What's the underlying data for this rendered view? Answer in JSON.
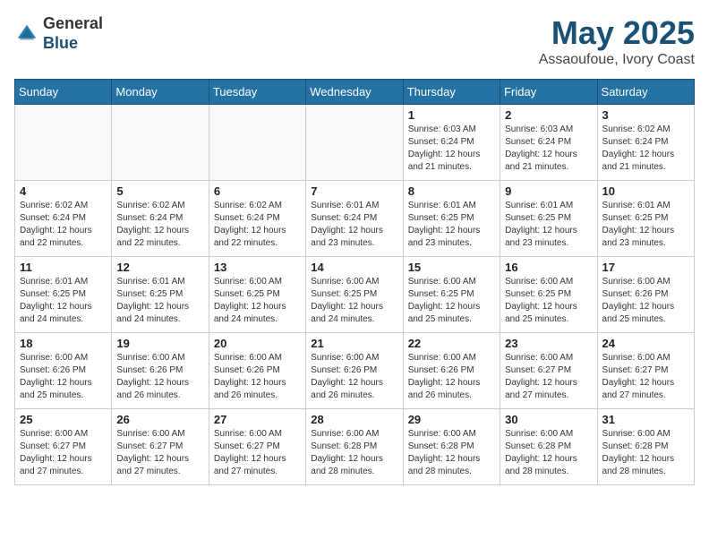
{
  "header": {
    "logo_general": "General",
    "logo_blue": "Blue",
    "month": "May 2025",
    "location": "Assaoufoue, Ivory Coast"
  },
  "weekdays": [
    "Sunday",
    "Monday",
    "Tuesday",
    "Wednesday",
    "Thursday",
    "Friday",
    "Saturday"
  ],
  "weeks": [
    [
      {
        "day": "",
        "info": ""
      },
      {
        "day": "",
        "info": ""
      },
      {
        "day": "",
        "info": ""
      },
      {
        "day": "",
        "info": ""
      },
      {
        "day": "1",
        "info": "Sunrise: 6:03 AM\nSunset: 6:24 PM\nDaylight: 12 hours\nand 21 minutes."
      },
      {
        "day": "2",
        "info": "Sunrise: 6:03 AM\nSunset: 6:24 PM\nDaylight: 12 hours\nand 21 minutes."
      },
      {
        "day": "3",
        "info": "Sunrise: 6:02 AM\nSunset: 6:24 PM\nDaylight: 12 hours\nand 21 minutes."
      }
    ],
    [
      {
        "day": "4",
        "info": "Sunrise: 6:02 AM\nSunset: 6:24 PM\nDaylight: 12 hours\nand 22 minutes."
      },
      {
        "day": "5",
        "info": "Sunrise: 6:02 AM\nSunset: 6:24 PM\nDaylight: 12 hours\nand 22 minutes."
      },
      {
        "day": "6",
        "info": "Sunrise: 6:02 AM\nSunset: 6:24 PM\nDaylight: 12 hours\nand 22 minutes."
      },
      {
        "day": "7",
        "info": "Sunrise: 6:01 AM\nSunset: 6:24 PM\nDaylight: 12 hours\nand 23 minutes."
      },
      {
        "day": "8",
        "info": "Sunrise: 6:01 AM\nSunset: 6:25 PM\nDaylight: 12 hours\nand 23 minutes."
      },
      {
        "day": "9",
        "info": "Sunrise: 6:01 AM\nSunset: 6:25 PM\nDaylight: 12 hours\nand 23 minutes."
      },
      {
        "day": "10",
        "info": "Sunrise: 6:01 AM\nSunset: 6:25 PM\nDaylight: 12 hours\nand 23 minutes."
      }
    ],
    [
      {
        "day": "11",
        "info": "Sunrise: 6:01 AM\nSunset: 6:25 PM\nDaylight: 12 hours\nand 24 minutes."
      },
      {
        "day": "12",
        "info": "Sunrise: 6:01 AM\nSunset: 6:25 PM\nDaylight: 12 hours\nand 24 minutes."
      },
      {
        "day": "13",
        "info": "Sunrise: 6:00 AM\nSunset: 6:25 PM\nDaylight: 12 hours\nand 24 minutes."
      },
      {
        "day": "14",
        "info": "Sunrise: 6:00 AM\nSunset: 6:25 PM\nDaylight: 12 hours\nand 24 minutes."
      },
      {
        "day": "15",
        "info": "Sunrise: 6:00 AM\nSunset: 6:25 PM\nDaylight: 12 hours\nand 25 minutes."
      },
      {
        "day": "16",
        "info": "Sunrise: 6:00 AM\nSunset: 6:25 PM\nDaylight: 12 hours\nand 25 minutes."
      },
      {
        "day": "17",
        "info": "Sunrise: 6:00 AM\nSunset: 6:26 PM\nDaylight: 12 hours\nand 25 minutes."
      }
    ],
    [
      {
        "day": "18",
        "info": "Sunrise: 6:00 AM\nSunset: 6:26 PM\nDaylight: 12 hours\nand 25 minutes."
      },
      {
        "day": "19",
        "info": "Sunrise: 6:00 AM\nSunset: 6:26 PM\nDaylight: 12 hours\nand 26 minutes."
      },
      {
        "day": "20",
        "info": "Sunrise: 6:00 AM\nSunset: 6:26 PM\nDaylight: 12 hours\nand 26 minutes."
      },
      {
        "day": "21",
        "info": "Sunrise: 6:00 AM\nSunset: 6:26 PM\nDaylight: 12 hours\nand 26 minutes."
      },
      {
        "day": "22",
        "info": "Sunrise: 6:00 AM\nSunset: 6:26 PM\nDaylight: 12 hours\nand 26 minutes."
      },
      {
        "day": "23",
        "info": "Sunrise: 6:00 AM\nSunset: 6:27 PM\nDaylight: 12 hours\nand 27 minutes."
      },
      {
        "day": "24",
        "info": "Sunrise: 6:00 AM\nSunset: 6:27 PM\nDaylight: 12 hours\nand 27 minutes."
      }
    ],
    [
      {
        "day": "25",
        "info": "Sunrise: 6:00 AM\nSunset: 6:27 PM\nDaylight: 12 hours\nand 27 minutes."
      },
      {
        "day": "26",
        "info": "Sunrise: 6:00 AM\nSunset: 6:27 PM\nDaylight: 12 hours\nand 27 minutes."
      },
      {
        "day": "27",
        "info": "Sunrise: 6:00 AM\nSunset: 6:27 PM\nDaylight: 12 hours\nand 27 minutes."
      },
      {
        "day": "28",
        "info": "Sunrise: 6:00 AM\nSunset: 6:28 PM\nDaylight: 12 hours\nand 28 minutes."
      },
      {
        "day": "29",
        "info": "Sunrise: 6:00 AM\nSunset: 6:28 PM\nDaylight: 12 hours\nand 28 minutes."
      },
      {
        "day": "30",
        "info": "Sunrise: 6:00 AM\nSunset: 6:28 PM\nDaylight: 12 hours\nand 28 minutes."
      },
      {
        "day": "31",
        "info": "Sunrise: 6:00 AM\nSunset: 6:28 PM\nDaylight: 12 hours\nand 28 minutes."
      }
    ]
  ]
}
